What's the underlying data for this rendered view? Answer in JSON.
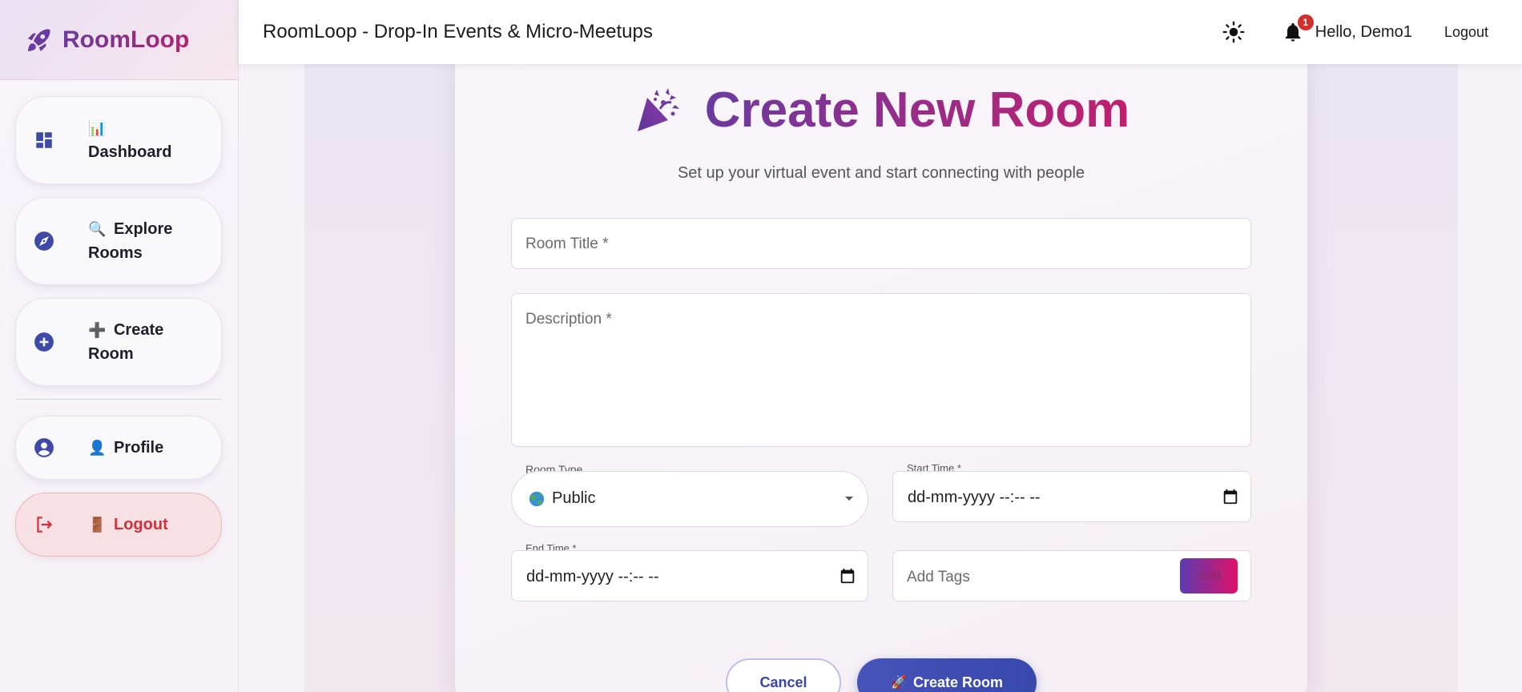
{
  "brand": {
    "name": "RoomLoop"
  },
  "header": {
    "title": "RoomLoop - Drop-In Events & Micro-Meetups",
    "notification_count": "1",
    "greeting": "Hello, Demo1",
    "logout_label": "Logout"
  },
  "sidebar": {
    "items": [
      {
        "emoji": "📊",
        "label": "Dashboard",
        "icon": "dashboard-icon"
      },
      {
        "emoji": "🔍",
        "label": "Explore Rooms",
        "icon": "compass-icon"
      },
      {
        "emoji": "➕",
        "label": "Create Room",
        "icon": "add-circle-icon"
      },
      {
        "emoji": "👤",
        "label": "Profile",
        "icon": "account-circle-icon"
      },
      {
        "emoji": "🚪",
        "label": "Logout",
        "icon": "logout-icon"
      }
    ]
  },
  "form": {
    "title": "Create New Room",
    "subtitle": "Set up your virtual event and start connecting with people",
    "room_title_placeholder": "Room Title *",
    "description_placeholder": "Description *",
    "room_type_label": "Room Type",
    "room_type_value": "Public",
    "start_time_label": "Start Time *",
    "start_time_value": "dd-mm-yyyy --:-- --",
    "end_time_label": "End Time *",
    "end_time_value": "dd-mm-yyyy --:-- --",
    "tags_placeholder": "Add Tags",
    "add_label": "Add",
    "cancel_label": "Cancel",
    "create_label": "Create Room",
    "create_emoji": "🚀"
  },
  "colors": {
    "accent_purple": "#6b3aa0",
    "accent_pink": "#c01f6e",
    "primary_blue": "#3948ac",
    "logout_red": "#d22f3a",
    "badge_red": "#d32f2f"
  }
}
